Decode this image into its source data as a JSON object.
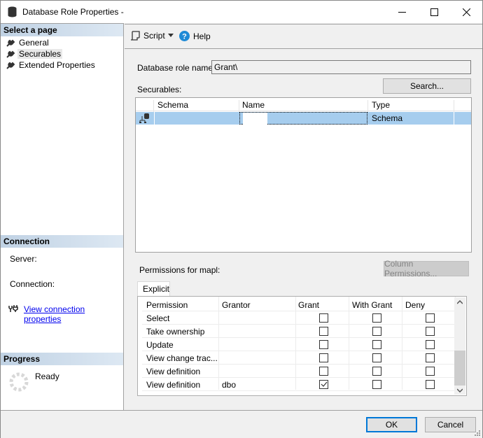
{
  "window": {
    "title": "Database Role Properties -",
    "minimize_icon": "minimize-icon",
    "maximize_icon": "maximize-icon",
    "close_icon": "close-icon"
  },
  "sidebar": {
    "select_page_header": "Select a page",
    "pages": [
      {
        "label": "General",
        "icon": "wrench-icon",
        "selected": false
      },
      {
        "label": "Securables",
        "icon": "wrench-icon",
        "selected": true
      },
      {
        "label": "Extended Properties",
        "icon": "wrench-icon",
        "selected": false
      }
    ],
    "connection_header": "Connection",
    "server_label": "Server:",
    "connection_label": "Connection:",
    "view_connection_link": "View connection properties",
    "progress_header": "Progress",
    "progress_status": "Ready"
  },
  "toolbar": {
    "script_label": "Script",
    "help_label": "Help"
  },
  "form": {
    "role_name_label": "Database role name:",
    "role_name_value": "Grant\\",
    "securables_label": "Securables:",
    "search_button": "Search...",
    "securables_columns": [
      "Schema",
      "Name",
      "Type"
    ],
    "securables_rows": [
      {
        "schema": "",
        "name": "",
        "type": "Schema"
      }
    ],
    "permissions_label": "Permissions for mapl:",
    "column_permissions_button": "Column Permissions...",
    "tab_explicit": "Explicit",
    "permission_columns": [
      "Permission",
      "Grantor",
      "Grant",
      "With Grant",
      "Deny"
    ],
    "permission_rows": [
      {
        "permission": "Select",
        "grantor": "",
        "grant": false,
        "with_grant": false,
        "deny": false
      },
      {
        "permission": "Take ownership",
        "grantor": "",
        "grant": false,
        "with_grant": false,
        "deny": false
      },
      {
        "permission": "Update",
        "grantor": "",
        "grant": false,
        "with_grant": false,
        "deny": false
      },
      {
        "permission": "View change trac...",
        "grantor": "",
        "grant": false,
        "with_grant": false,
        "deny": false
      },
      {
        "permission": "View definition",
        "grantor": "",
        "grant": false,
        "with_grant": false,
        "deny": false
      },
      {
        "permission": "View definition",
        "grantor": "dbo",
        "grant": true,
        "with_grant": false,
        "deny": false
      }
    ]
  },
  "footer": {
    "ok_button": "OK",
    "cancel_button": "Cancel"
  },
  "colors": {
    "selected_row": "#a6cdee",
    "section_header": "#c0d2e4",
    "default_button_border": "#0078d7"
  }
}
